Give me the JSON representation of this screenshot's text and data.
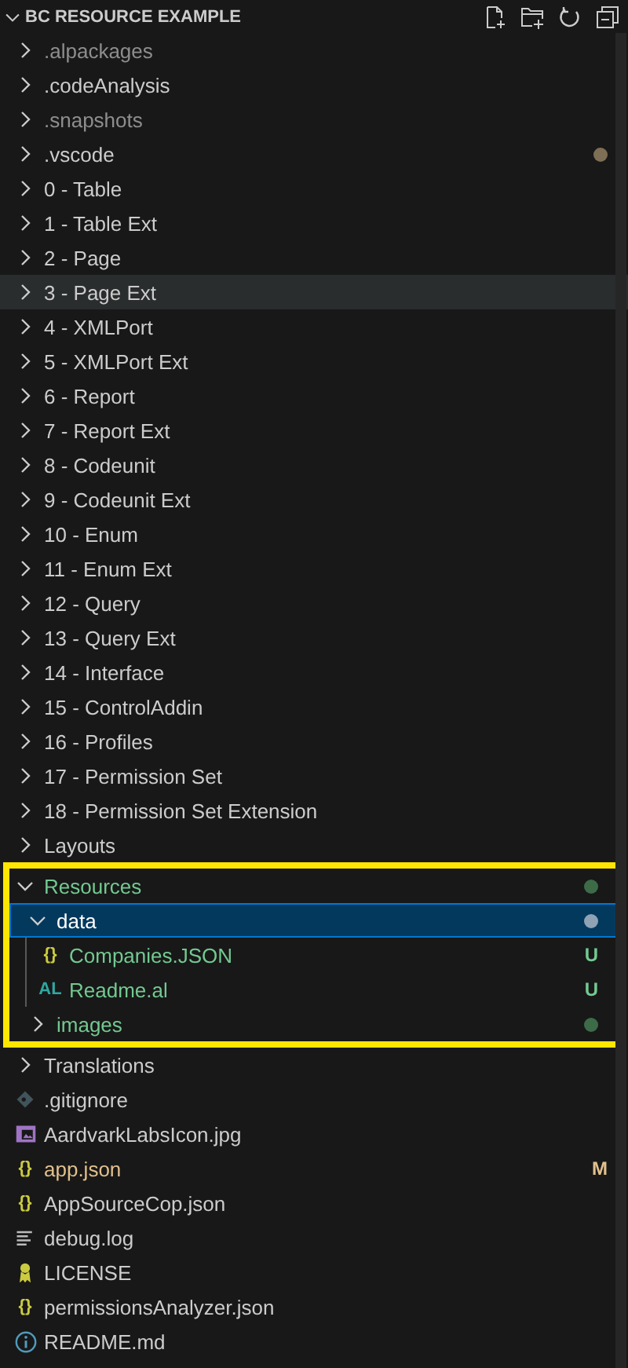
{
  "header": {
    "title": "BC RESOURCE EXAMPLE",
    "expanded": true
  },
  "tree": [
    {
      "kind": "folder",
      "name": ".alpackages",
      "expanded": false,
      "ignored": true,
      "selected": false,
      "hovered": false
    },
    {
      "kind": "folder",
      "name": ".codeAnalysis",
      "expanded": false,
      "ignored": false,
      "selected": false,
      "hovered": false
    },
    {
      "kind": "folder",
      "name": ".snapshots",
      "expanded": false,
      "ignored": true,
      "selected": false,
      "hovered": false
    },
    {
      "kind": "folder",
      "name": ".vscode",
      "expanded": false,
      "ignored": false,
      "selected": false,
      "hovered": false,
      "dot": {
        "color": "#7d6e55"
      }
    },
    {
      "kind": "folder",
      "name": "0 - Table",
      "expanded": false,
      "ignored": false,
      "selected": false,
      "hovered": false
    },
    {
      "kind": "folder",
      "name": "1 - Table Ext",
      "expanded": false,
      "ignored": false,
      "selected": false,
      "hovered": false
    },
    {
      "kind": "folder",
      "name": "2 - Page",
      "expanded": false,
      "ignored": false,
      "selected": false,
      "hovered": false
    },
    {
      "kind": "folder",
      "name": "3 - Page Ext",
      "expanded": false,
      "ignored": false,
      "selected": false,
      "hovered": true
    },
    {
      "kind": "folder",
      "name": "4 - XMLPort",
      "expanded": false,
      "ignored": false,
      "selected": false,
      "hovered": false
    },
    {
      "kind": "folder",
      "name": "5 - XMLPort Ext",
      "expanded": false,
      "ignored": false,
      "selected": false,
      "hovered": false
    },
    {
      "kind": "folder",
      "name": "6 - Report",
      "expanded": false,
      "ignored": false,
      "selected": false,
      "hovered": false
    },
    {
      "kind": "folder",
      "name": "7 - Report Ext",
      "expanded": false,
      "ignored": false,
      "selected": false,
      "hovered": false
    },
    {
      "kind": "folder",
      "name": "8 - Codeunit",
      "expanded": false,
      "ignored": false,
      "selected": false,
      "hovered": false
    },
    {
      "kind": "folder",
      "name": "9 - Codeunit Ext",
      "expanded": false,
      "ignored": false,
      "selected": false,
      "hovered": false
    },
    {
      "kind": "folder",
      "name": "10 - Enum",
      "expanded": false,
      "ignored": false,
      "selected": false,
      "hovered": false
    },
    {
      "kind": "folder",
      "name": "11 - Enum Ext",
      "expanded": false,
      "ignored": false,
      "selected": false,
      "hovered": false
    },
    {
      "kind": "folder",
      "name": "12 - Query",
      "expanded": false,
      "ignored": false,
      "selected": false,
      "hovered": false
    },
    {
      "kind": "folder",
      "name": "13 - Query Ext",
      "expanded": false,
      "ignored": false,
      "selected": false,
      "hovered": false
    },
    {
      "kind": "folder",
      "name": "14 - Interface",
      "expanded": false,
      "ignored": false,
      "selected": false,
      "hovered": false
    },
    {
      "kind": "folder",
      "name": "15 - ControlAddin",
      "expanded": false,
      "ignored": false,
      "selected": false,
      "hovered": false
    },
    {
      "kind": "folder",
      "name": "16 - Profiles",
      "expanded": false,
      "ignored": false,
      "selected": false,
      "hovered": false
    },
    {
      "kind": "folder",
      "name": "17 - Permission Set",
      "expanded": false,
      "ignored": false,
      "selected": false,
      "hovered": false
    },
    {
      "kind": "folder",
      "name": "18 - Permission Set Extension",
      "expanded": false,
      "ignored": false,
      "selected": false,
      "hovered": false
    },
    {
      "kind": "folder",
      "name": "Layouts",
      "expanded": false,
      "ignored": false,
      "selected": false,
      "hovered": false
    },
    {
      "kind": "folder",
      "name": "Resources",
      "expanded": true,
      "ignored": false,
      "selected": false,
      "hovered": false,
      "color": "#73c991",
      "highlight": true,
      "dot": {
        "color": "#3d6b48"
      },
      "children": [
        {
          "kind": "folder",
          "name": "data",
          "expanded": true,
          "ignored": false,
          "selected": true,
          "hovered": false,
          "dot": {
            "color": "#8fa3b5"
          },
          "children": [
            {
              "kind": "json",
              "name": "Companies.JSON",
              "icon_label": "{}",
              "ignored": false,
              "selected": false,
              "hovered": false,
              "color": "#73c991",
              "badge": "U"
            },
            {
              "kind": "al",
              "name": "Readme.al",
              "icon_label": "AL",
              "ignored": false,
              "selected": false,
              "hovered": false,
              "color": "#73c991",
              "badge": "U"
            }
          ]
        },
        {
          "kind": "folder",
          "name": "images",
          "expanded": false,
          "ignored": false,
          "selected": false,
          "hovered": false,
          "color": "#73c991",
          "dot": {
            "color": "#3d6b48"
          }
        }
      ]
    },
    {
      "kind": "folder",
      "name": "Translations",
      "expanded": false,
      "ignored": false,
      "selected": false,
      "hovered": false
    },
    {
      "kind": "git",
      "name": ".gitignore",
      "ignored": false,
      "selected": false,
      "hovered": false
    },
    {
      "kind": "image",
      "name": "AardvarkLabsIcon.jpg",
      "ignored": false,
      "selected": false,
      "hovered": false
    },
    {
      "kind": "json",
      "name": "app.json",
      "icon_label": "{}",
      "ignored": false,
      "selected": false,
      "hovered": false,
      "color": "#e2c08d",
      "badge": "M"
    },
    {
      "kind": "json",
      "name": "AppSourceCop.json",
      "icon_label": "{}",
      "ignored": false,
      "selected": false,
      "hovered": false
    },
    {
      "kind": "log",
      "name": "debug.log",
      "ignored": false,
      "selected": false,
      "hovered": false
    },
    {
      "kind": "license",
      "name": "LICENSE",
      "ignored": false,
      "selected": false,
      "hovered": false
    },
    {
      "kind": "json",
      "name": "permissionsAnalyzer.json",
      "icon_label": "{}",
      "ignored": false,
      "selected": false,
      "hovered": false
    },
    {
      "kind": "info",
      "name": "README.md",
      "ignored": false,
      "selected": false,
      "hovered": false
    }
  ]
}
